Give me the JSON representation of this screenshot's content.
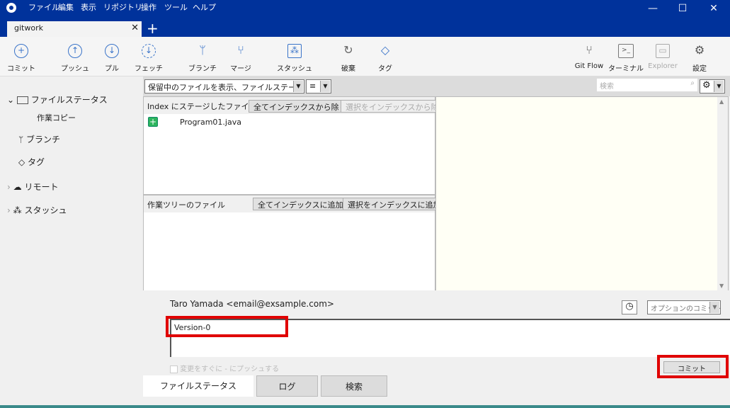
{
  "app": {
    "menu": [
      "ファイル",
      "編集",
      "表示",
      "リポジトリ",
      "操作",
      "ツール",
      "ヘルプ"
    ],
    "tab": "gitwork",
    "new_tab": "+",
    "close": "✕",
    "minimize": "—",
    "maximize": "☐",
    "win_close": "✕"
  },
  "toolbar": {
    "left": [
      {
        "label": "コミット",
        "icon": "+"
      },
      {
        "label": "プッシュ",
        "icon": "↑"
      },
      {
        "label": "プル",
        "icon": "↓"
      },
      {
        "label": "フェッチ",
        "icon": "↓"
      },
      {
        "label": "ブランチ",
        "icon": "ᛘ"
      },
      {
        "label": "マージ",
        "icon": "⑂"
      },
      {
        "label": "スタッシュ",
        "icon": "⁂"
      },
      {
        "label": "破棄",
        "icon": "↻"
      },
      {
        "label": "タグ",
        "icon": "◇"
      }
    ],
    "right": [
      {
        "label": "Git Flow",
        "icon": "⑂"
      },
      {
        "label": "ターミナル",
        "icon": ">_"
      },
      {
        "label": "Explorer",
        "icon": "▭"
      },
      {
        "label": "設定",
        "icon": "⚙"
      }
    ]
  },
  "sidebar": {
    "file_status": "ファイルステータス",
    "working_copy": "作業コピー",
    "branch": "ブランチ",
    "tag": "タグ",
    "remote": "リモート",
    "stash": "スタッシュ"
  },
  "filter": {
    "view": "保留中のファイルを表示、ファイルステータス順",
    "list_icon": "≡",
    "search_placeholder": "検索"
  },
  "staged": {
    "title": "Index にステージしたファイル",
    "remove_all": "全てインデックスから除く",
    "remove_sel": "選択をインデックスから除く",
    "files": [
      "Program01.java"
    ]
  },
  "working": {
    "title": "作業ツリーのファイル",
    "add_all": "全てインデックスに追加",
    "add_sel": "選択をインデックスに追加"
  },
  "commit": {
    "author": "Taro Yamada <email@exsample.com>",
    "options": "オプションのコミット",
    "message": "Version-0",
    "push_label": "変更をすぐに - にプッシュする",
    "commit_button": "コミット"
  },
  "bottom_tabs": [
    "ファイルステータス",
    "ログ",
    "検索"
  ],
  "colors": {
    "title_bar": "#00329b",
    "highlight": "#e00000",
    "accent": "#3a74c9"
  }
}
